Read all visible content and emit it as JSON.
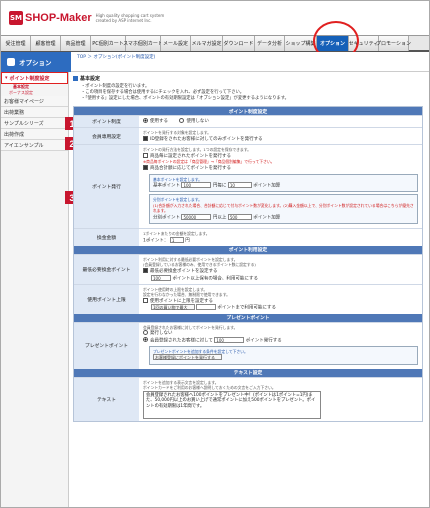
{
  "header": {
    "logo_mark": "SM",
    "logo_text": "SHOP-Maker",
    "tagline": "High quality shopping cart system created by ASP internet Inc."
  },
  "nav": {
    "tabs": [
      "受注管理",
      "顧客管理",
      "商品管理",
      "PC個別カート",
      "スマホ個別カート",
      "メール設定",
      "メルマガ設定",
      "ダウンロード",
      "データ分析",
      "ショップ構築",
      "オプション",
      "セキュリティ",
      "プロモーション"
    ]
  },
  "subheader": {
    "title": "オプション",
    "breadcrumb": "TOP ＞ オプション(ポイント制度設定)"
  },
  "sidebar": {
    "items": [
      "ポイント制度設定",
      "基本設定",
      "ボーナス設定",
      "お客様マイページ",
      "出荷業務",
      "サンプルシリーズ",
      "出荷作成",
      "アイエンサンプル"
    ]
  },
  "section": {
    "title": "基本設定",
    "notes": [
      "・ポイント制度の設定を行います。",
      "・この項目を保存する場合は使用するにチェックを入れ、必ず設定を行って下さい。",
      "・「使用する」設定にした場合、ポイントの有効期限設定は「オプション設定」が変更するようになります。"
    ]
  },
  "table": {
    "bar_basic": "ポイント制度設定",
    "row_usage": {
      "label": "ポイント制度",
      "opt_use": "使用する",
      "opt_notuse": "使用しない"
    },
    "row_member": {
      "label": "会員専用設定",
      "note": "ポイントを発行する対象を設定します。",
      "check": "ID登録をされたお客様に対してのみポイントを発行する"
    },
    "row_issue": {
      "label": "ポイント発行",
      "note1": "ポイントの発行方法を設定します。1つの設定を保存できます。",
      "check1": "商品毎に設定されたポイントを発行する",
      "red1": "※商品毎ポイントの設定は「商品管理」→「商品個別編集」で行って下さい。",
      "check2": "商品合計額に応じてポイントを発行する",
      "sub1_note": "基本ポイントを設定します。",
      "sub1_prefix": "基本ポイント",
      "sub1_v1": "100",
      "sub1_mid": "円毎に",
      "sub1_v2": "10",
      "sub1_suffix": "ポイント加算",
      "sub2_note": "分別ポイントを設定します。",
      "sub2_red": "(1)合計額が入力された場合、合計額に応じて付与ポイント数が変化します。(2)購入金額以上で、分別ポイント数が設定されている場合はこちらが優先されます。",
      "sub2_prefix": "分別ポイント",
      "sub2_v1": "50000",
      "sub2_mid": "円以上",
      "sub2_v2": "500",
      "sub2_suffix": "ポイント加算"
    },
    "row_price": {
      "label": "換金金額",
      "note": "1ポイントあたりの金額を設定します。",
      "prefix": "1ポイント：",
      "value": "1",
      "suffix": "円"
    },
    "bar_usage": "ポイント利用設定",
    "row_min": {
      "label": "最低必要換金ポイント",
      "note": "ポイント利用に対する最低必要ポイントを設定します。",
      "note2": "(会員登録しているお客様のみ、使用できるポイント数に設定する)",
      "check": "最低必要換金ポイントを設定する",
      "value": "100",
      "suffix": "ポイント以上保有の場合、利用可能にする"
    },
    "row_limit": {
      "label": "使用ポイント上限",
      "note": "ポイント使用時の上限を設定します。",
      "note2": "設定を行わなかった場合、無制限で使用できます。",
      "check": "使用ポイントに上限を設定する",
      "sel": "1回の買い物で最大",
      "suffix": "ポイントまで利用可能にする"
    },
    "bar_present": "プレゼントポイント",
    "row_present": {
      "label": "プレゼントポイント",
      "note": "会員登録されたお客様に対してポイントを発行します。",
      "opt1": "発行しない",
      "opt2_prefix": "会員登録されたお客様に対して",
      "value": "100",
      "opt2_suffix": "ポイント発行する",
      "sub_note": "プレゼントポイントを追加する条件を設定して下さい。",
      "sub_sel": "お客様登録にポイントを発行する"
    },
    "bar_text": "テキスト設定",
    "row_text": {
      "label": "テキスト",
      "note": "ポイントを追加する表示文言を設定します。",
      "note2": "ポイントカードをご利用のお客様へ説明しておくための文言をご入力下さい。",
      "content": "会員登録されたお客様へ100ポイントをプレゼント中！(ポイントは1ポイント=1円)また、50,000円以上のお買い上げで通常ポイントに加え500ポイントをプレゼント。ポイントの有効期限は1年間です。"
    }
  },
  "badges": [
    "1",
    "2",
    "3"
  ]
}
